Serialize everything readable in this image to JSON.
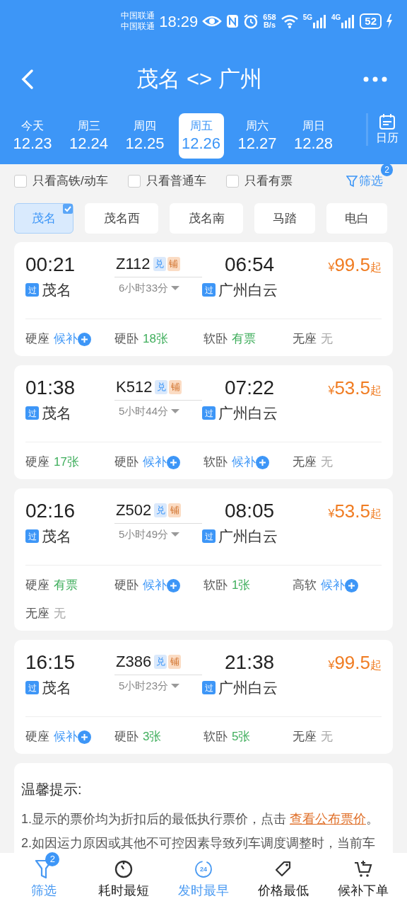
{
  "status_bar": {
    "carriers": [
      "中国联通",
      "中国联通"
    ],
    "time": "18:29",
    "speed": [
      "658",
      "B/s"
    ],
    "net_a": "5G",
    "net_b": "4G",
    "battery": "52"
  },
  "header": {
    "title": "茂名 <> 广州",
    "calendar_label": "日历"
  },
  "dates": [
    {
      "weekday": "今天",
      "date": "12.23",
      "selected": false
    },
    {
      "weekday": "周三",
      "date": "12.24",
      "selected": false
    },
    {
      "weekday": "周四",
      "date": "12.25",
      "selected": false
    },
    {
      "weekday": "周五",
      "date": "12.26",
      "selected": true
    },
    {
      "weekday": "周六",
      "date": "12.27",
      "selected": false
    },
    {
      "weekday": "周日",
      "date": "12.28",
      "selected": false
    }
  ],
  "filters": [
    {
      "label": "只看高铁/动车",
      "checked": false
    },
    {
      "label": "只看普通车",
      "checked": false
    },
    {
      "label": "只看有票",
      "checked": false
    }
  ],
  "filter_button": {
    "label": "筛选",
    "badge": "2"
  },
  "stations": [
    {
      "label": "茂名",
      "selected": true
    },
    {
      "label": "茂名西",
      "selected": false
    },
    {
      "label": "茂名南",
      "selected": false
    },
    {
      "label": "马踏",
      "selected": false
    },
    {
      "label": "电白",
      "selected": false
    }
  ],
  "trains": [
    {
      "depart": "00:21",
      "from_tag": "过",
      "from": "茂名",
      "number": "Z112",
      "tags": [
        "兑",
        "铺"
      ],
      "duration": "6小时33分",
      "arrive": "06:54",
      "to_tag": "过",
      "to": "广州白云",
      "price_symbol": "¥",
      "price": "99.5",
      "price_suffix": "起",
      "seats": [
        {
          "name": "硬座",
          "value": "候补",
          "kind": "waitlist"
        },
        {
          "name": "硬卧",
          "value": "18张",
          "kind": "available"
        },
        {
          "name": "软卧",
          "value": "有票",
          "kind": "available"
        },
        {
          "name": "无座",
          "value": "无",
          "kind": "none"
        }
      ]
    },
    {
      "depart": "01:38",
      "from_tag": "过",
      "from": "茂名",
      "number": "K512",
      "tags": [
        "兑",
        "铺"
      ],
      "duration": "5小时44分",
      "arrive": "07:22",
      "to_tag": "过",
      "to": "广州白云",
      "price_symbol": "¥",
      "price": "53.5",
      "price_suffix": "起",
      "seats": [
        {
          "name": "硬座",
          "value": "17张",
          "kind": "available"
        },
        {
          "name": "硬卧",
          "value": "候补",
          "kind": "waitlist"
        },
        {
          "name": "软卧",
          "value": "候补",
          "kind": "waitlist"
        },
        {
          "name": "无座",
          "value": "无",
          "kind": "none"
        }
      ]
    },
    {
      "depart": "02:16",
      "from_tag": "过",
      "from": "茂名",
      "number": "Z502",
      "tags": [
        "兑",
        "铺"
      ],
      "duration": "5小时49分",
      "arrive": "08:05",
      "to_tag": "过",
      "to": "广州白云",
      "price_symbol": "¥",
      "price": "53.5",
      "price_suffix": "起",
      "seats": [
        {
          "name": "硬座",
          "value": "有票",
          "kind": "available"
        },
        {
          "name": "硬卧",
          "value": "候补",
          "kind": "waitlist"
        },
        {
          "name": "软卧",
          "value": "1张",
          "kind": "available"
        },
        {
          "name": "高软",
          "value": "候补",
          "kind": "waitlist"
        },
        {
          "name": "无座",
          "value": "无",
          "kind": "none"
        }
      ]
    },
    {
      "depart": "16:15",
      "from_tag": "过",
      "from": "茂名",
      "number": "Z386",
      "tags": [
        "兑",
        "铺"
      ],
      "duration": "5小时23分",
      "arrive": "21:38",
      "to_tag": "过",
      "to": "广州白云",
      "price_symbol": "¥",
      "price": "99.5",
      "price_suffix": "起",
      "seats": [
        {
          "name": "硬座",
          "value": "候补",
          "kind": "waitlist"
        },
        {
          "name": "硬卧",
          "value": "3张",
          "kind": "available"
        },
        {
          "name": "软卧",
          "value": "5张",
          "kind": "available"
        },
        {
          "name": "无座",
          "value": "无",
          "kind": "none"
        }
      ]
    }
  ],
  "tips": {
    "title": "温馨提示:",
    "items": [
      {
        "text": "1.显示的票价均为折扣后的最低执行票价，点击 ",
        "link": "查看公布票价",
        "after": "。"
      },
      {
        "text": "2.如因运力原因或其他不可控因素导致列车调度调整时，当前车"
      }
    ]
  },
  "bottom_nav": [
    {
      "label": "筛选",
      "kind": "filter",
      "badge": "2",
      "selected": true
    },
    {
      "label": "耗时最短",
      "kind": "timer",
      "selected": false
    },
    {
      "label": "发时最早",
      "kind": "clock",
      "icon_text": "24",
      "selected": true
    },
    {
      "label": "价格最低",
      "kind": "tag",
      "selected": false
    },
    {
      "label": "候补下单",
      "kind": "cart",
      "selected": false
    }
  ]
}
